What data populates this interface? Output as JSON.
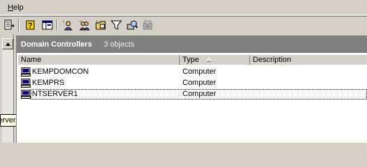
{
  "menu": {
    "help_label_first": "H",
    "help_label_rest": "elp"
  },
  "toolbar": {
    "buttons": [
      {
        "name": "export-list-icon"
      },
      {
        "name": "help-icon"
      },
      {
        "name": "show-hide-tree-icon"
      },
      {
        "name": "new-user-icon"
      },
      {
        "name": "new-group-icon"
      },
      {
        "name": "new-ou-icon"
      },
      {
        "name": "filter-icon"
      },
      {
        "name": "find-icon"
      },
      {
        "name": "add-to-group-icon"
      }
    ]
  },
  "left_pane": {
    "tooltip_text": "ervers"
  },
  "pane": {
    "title": "Domain Controllers",
    "object_count": "3 objects"
  },
  "columns": {
    "name": "Name",
    "type": "Type",
    "description": "Description"
  },
  "rows": [
    {
      "name": "KEMPDOMCON",
      "type": "Computer"
    },
    {
      "name": "KEMPRS",
      "type": "Computer"
    },
    {
      "name": "NTSERVER1",
      "type": "Computer"
    }
  ],
  "colors": {
    "header_bg": "#808080",
    "face": "#d4d0c8",
    "tooltip_bg": "#ffffe1"
  }
}
